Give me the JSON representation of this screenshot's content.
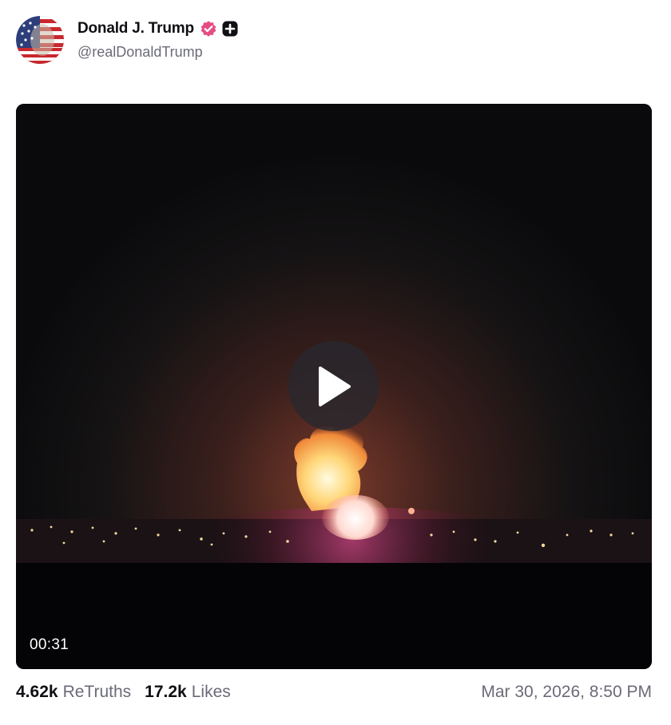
{
  "post": {
    "author": {
      "name": "Donald J. Trump",
      "handle": "@realDonaldTrump",
      "avatar": "avatar-image",
      "badges": [
        "verified-icon",
        "plus-badge-icon"
      ]
    },
    "media": {
      "type": "video",
      "duration": "00:31",
      "play_icon": "play-icon"
    },
    "stats": {
      "retruths_count": "4.62k",
      "retruths_label": "ReTruths",
      "likes_count": "17.2k",
      "likes_label": "Likes"
    },
    "timestamp": "Mar 30, 2026, 8:50 PM"
  },
  "colors": {
    "verified": "#e64c84",
    "text_primary": "#0f0f14",
    "text_secondary": "#6b6b78"
  }
}
